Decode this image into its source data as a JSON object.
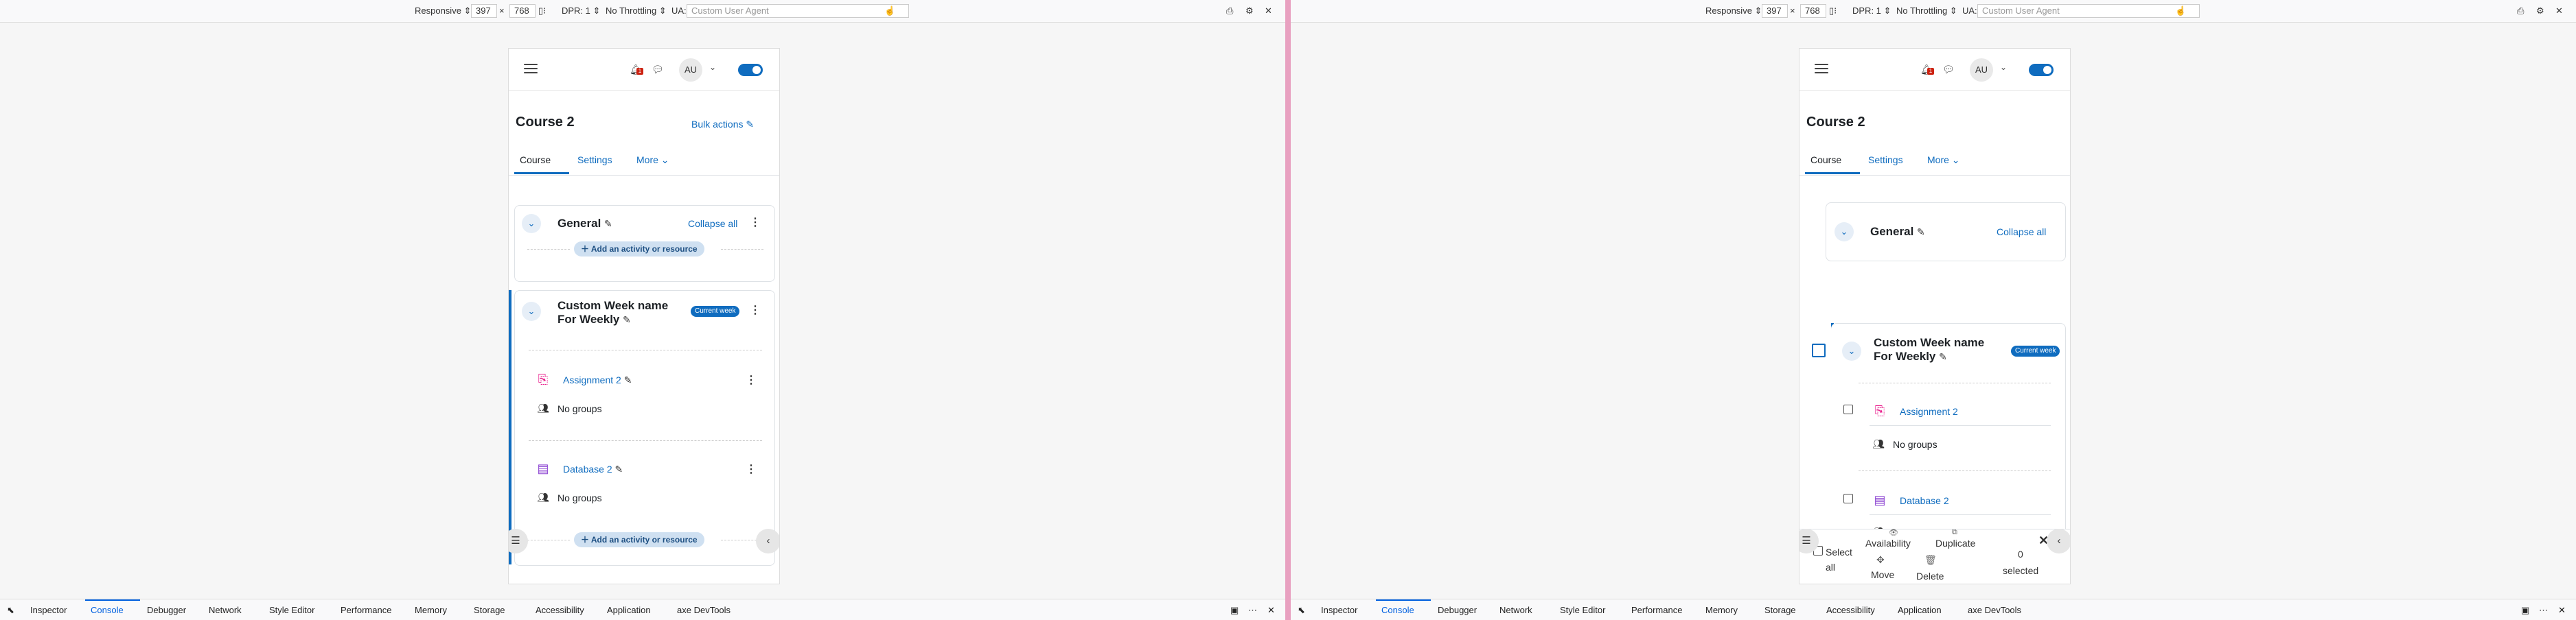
{
  "devtools_toolbar": {
    "responsive_label": "Responsive",
    "width": "397",
    "times": "×",
    "height": "768",
    "dpr_label": "DPR: 1",
    "throttling_label": "No Throttling",
    "ua_label": "UA:",
    "ua_placeholder": "Custom User Agent"
  },
  "devtools_tabs": [
    "Inspector",
    "Console",
    "Debugger",
    "Network",
    "Style Editor",
    "Performance",
    "Memory",
    "Storage",
    "Accessibility",
    "Application",
    "axe DevTools"
  ],
  "devtools_active_tab": "Console",
  "header": {
    "notification_count": "1",
    "avatar_initials": "AU"
  },
  "course": {
    "title": "Course 2",
    "bulk_actions": "Bulk actions",
    "tabs": [
      "Course",
      "Settings",
      "More"
    ]
  },
  "sections": {
    "general": {
      "title": "General",
      "collapse_all": "Collapse all",
      "add_activity": "Add an activity or resource"
    },
    "week": {
      "title_line1": "Custom Week name",
      "title_line2": "For Weekly",
      "badge": "Current week",
      "add_activity": "Add an activity or resource",
      "activities": [
        {
          "name": "Assignment 2",
          "groups": "No groups"
        },
        {
          "name": "Database 2",
          "groups": "No groups"
        }
      ]
    }
  },
  "bulk_bar": {
    "select_all_line1": "Select",
    "select_all_line2": "all",
    "availability": "Availability",
    "duplicate": "Duplicate",
    "move": "Move",
    "delete": "Delete",
    "selected_count": "0",
    "selected_label": "selected"
  },
  "colors": {
    "accent": "#0f6cbf",
    "badge_red": "#cc2211",
    "divider": "#e8a0c0"
  },
  "icons": [
    "hamburger-icon",
    "bell-icon",
    "chat-icon",
    "chevron-down-icon",
    "pencil-icon",
    "kebab-icon",
    "assignment-icon",
    "database-icon",
    "groups-icon",
    "course-index-icon",
    "chevron-left-icon",
    "close-icon",
    "gear-icon",
    "console-icon"
  ]
}
